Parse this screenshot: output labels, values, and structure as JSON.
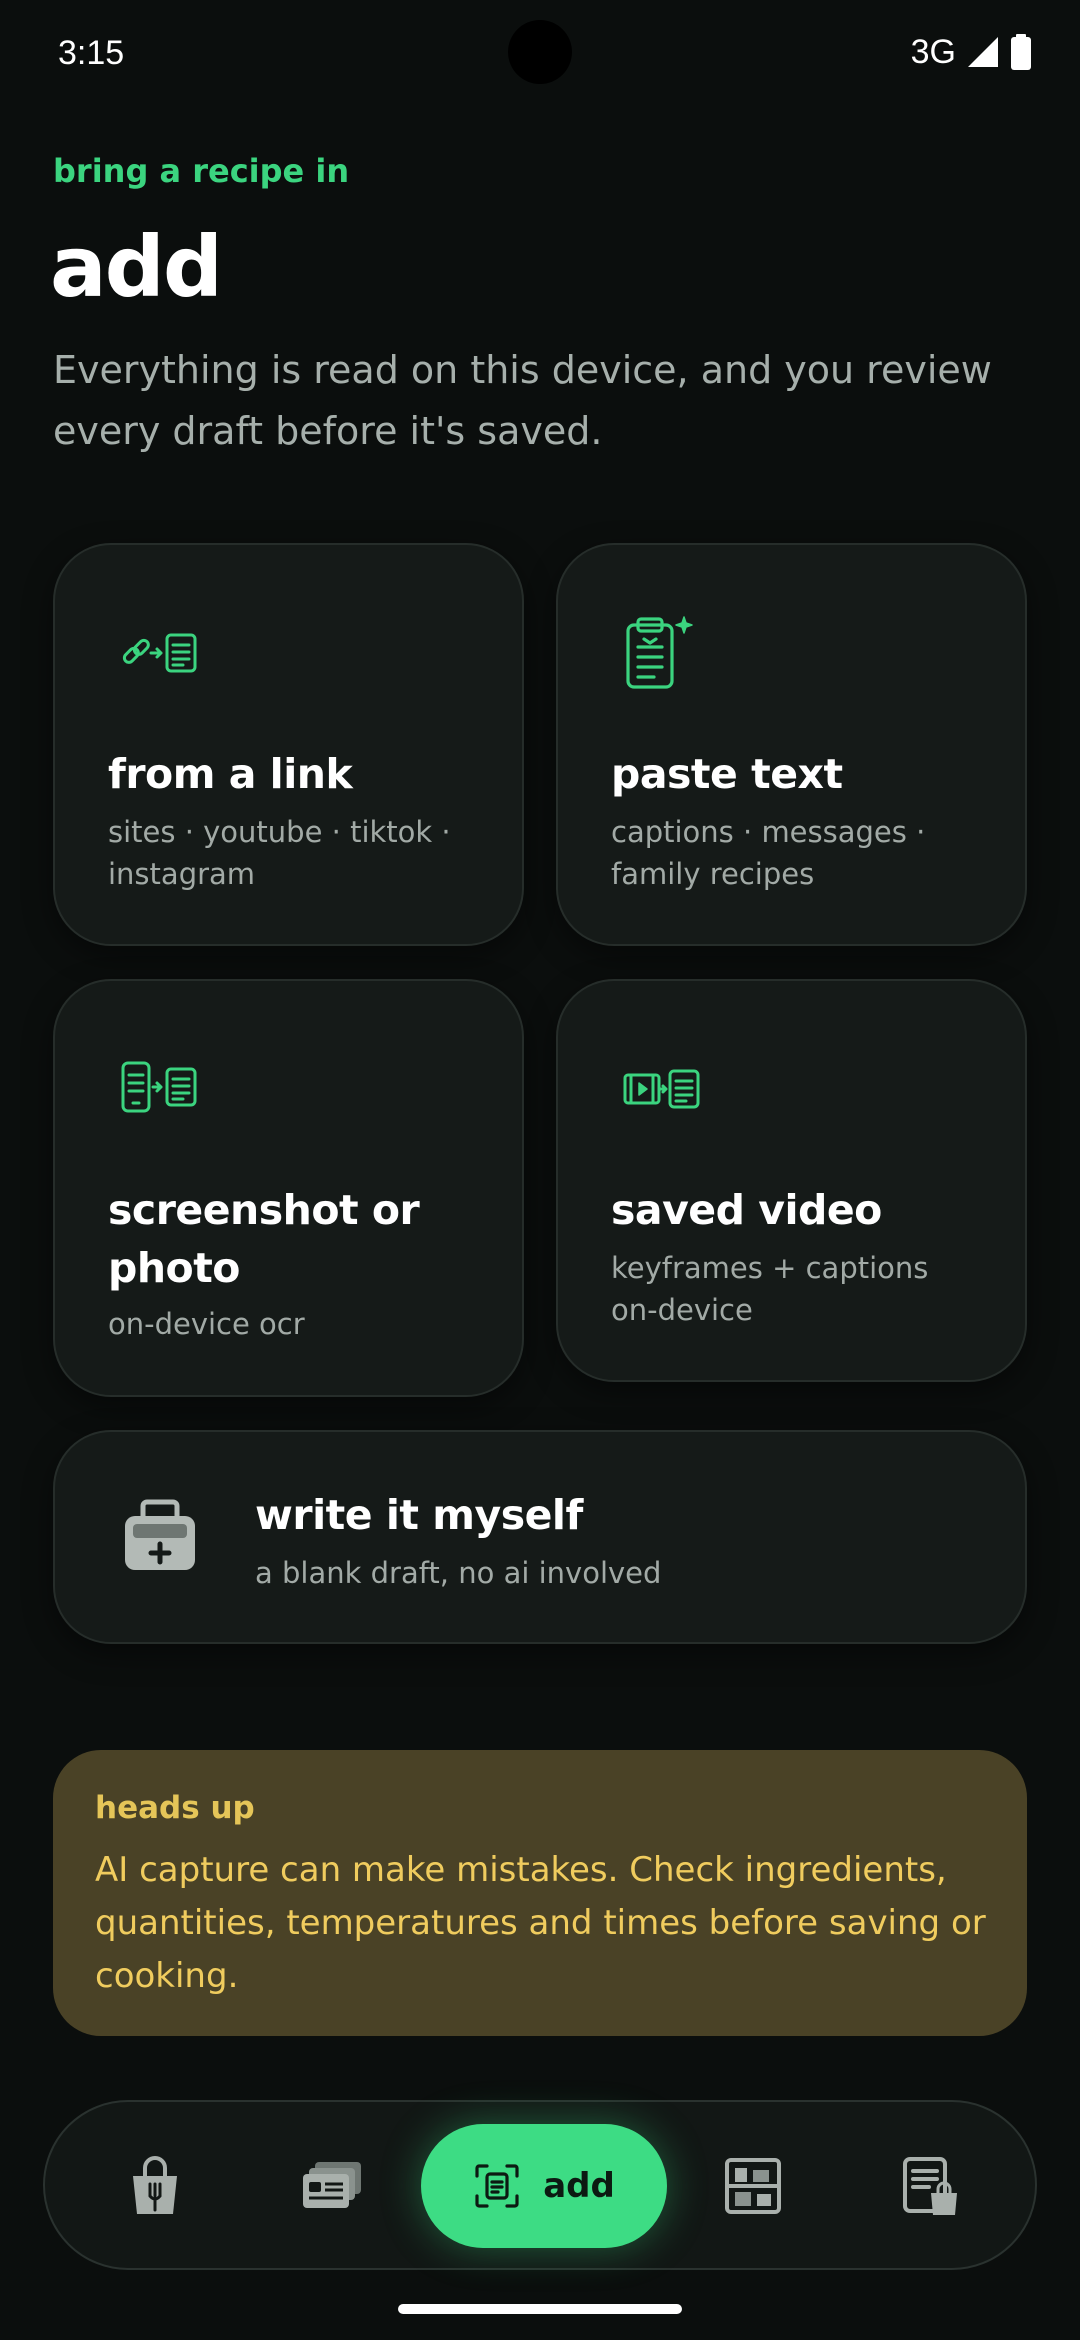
{
  "status_bar": {
    "time": "3:15",
    "network": "3G"
  },
  "header": {
    "eyebrow": "bring a recipe in",
    "title": "add",
    "subtitle": "Everything is read on this device, and you review every draft before it's saved."
  },
  "sources": [
    {
      "title": "from a link",
      "subtitle": "sites · youtube · tiktok · instagram",
      "icon": "link-to-recipe-icon"
    },
    {
      "title": "paste text",
      "subtitle": "captions · messages · family recipes",
      "icon": "clipboard-sparkle-icon"
    },
    {
      "title": "screenshot or photo",
      "subtitle": "on-device ocr",
      "icon": "phone-to-recipe-icon"
    },
    {
      "title": "saved video",
      "subtitle": "keyframes + captions on-device",
      "icon": "video-to-recipe-icon"
    },
    {
      "title": "write it myself",
      "subtitle": "a blank draft, no ai involved",
      "icon": "recipe-box-add-icon"
    }
  ],
  "notice": {
    "label": "heads up",
    "text": "AI capture can make mistakes. Check ingredients, quantities, temperatures and times before saving or cooking."
  },
  "nav": {
    "items": [
      {
        "icon": "shopping-bag-fork-icon"
      },
      {
        "icon": "recipe-cards-stack-icon"
      },
      {
        "icon": "scan-recipe-icon",
        "label": "add",
        "active": true
      },
      {
        "icon": "pantry-shelf-icon"
      },
      {
        "icon": "grocery-list-bag-icon"
      }
    ]
  },
  "colors": {
    "accent": "#3ddc84",
    "background": "#0b0e0d",
    "card": "#151a18",
    "warning_bg": "#4a4226",
    "warning_text": "#f0cc5e"
  }
}
